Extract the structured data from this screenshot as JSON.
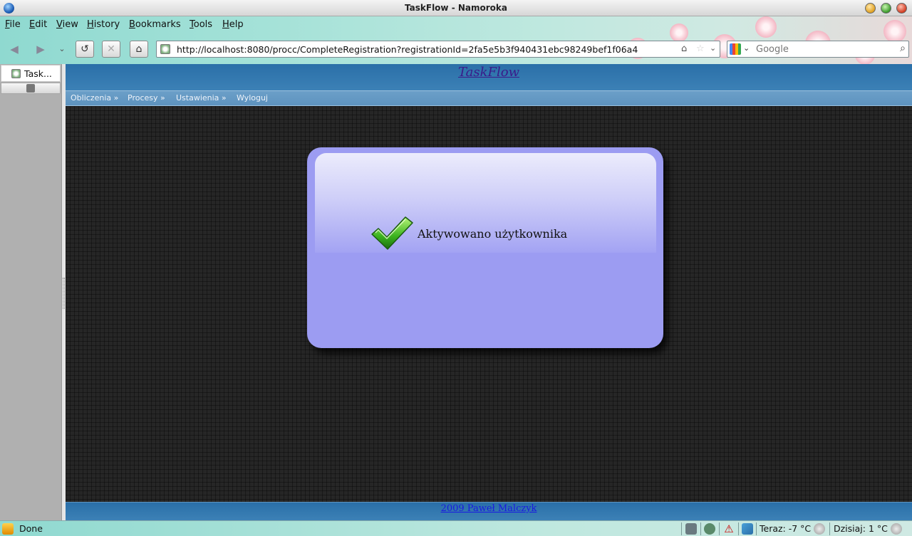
{
  "window": {
    "title": "TaskFlow - Namoroka"
  },
  "menubar": [
    "File",
    "Edit",
    "View",
    "History",
    "Bookmarks",
    "Tools",
    "Help"
  ],
  "toolbar": {
    "url": "http://localhost:8080/procc/CompleteRegistration?registrationId=2fa5e5b3f940431ebc98249bef1f06a4",
    "search_placeholder": "Google",
    "icons": [
      "back-arrow-icon",
      "forward-arrow-icon",
      "reload-icon",
      "stop-icon",
      "home-icon",
      "star-icon",
      "magnifier-icon"
    ]
  },
  "sidebar": {
    "tab_label": "Task..."
  },
  "page": {
    "site_title": "TaskFlow",
    "nav": [
      "Obliczenia »",
      "Procesy »",
      "Ustawienia »",
      "Wyloguj"
    ],
    "message": "Aktywowano użytkownika",
    "footer": "2009 Paweł Malczyk",
    "colors": {
      "header": "#3478b0",
      "card": "#9c9cf2",
      "page_bg": "#262626"
    }
  },
  "statusbar": {
    "status": "Done",
    "weather_now": "Teraz: -7 °C",
    "weather_today": "Dzisiaj: 1 °C"
  }
}
